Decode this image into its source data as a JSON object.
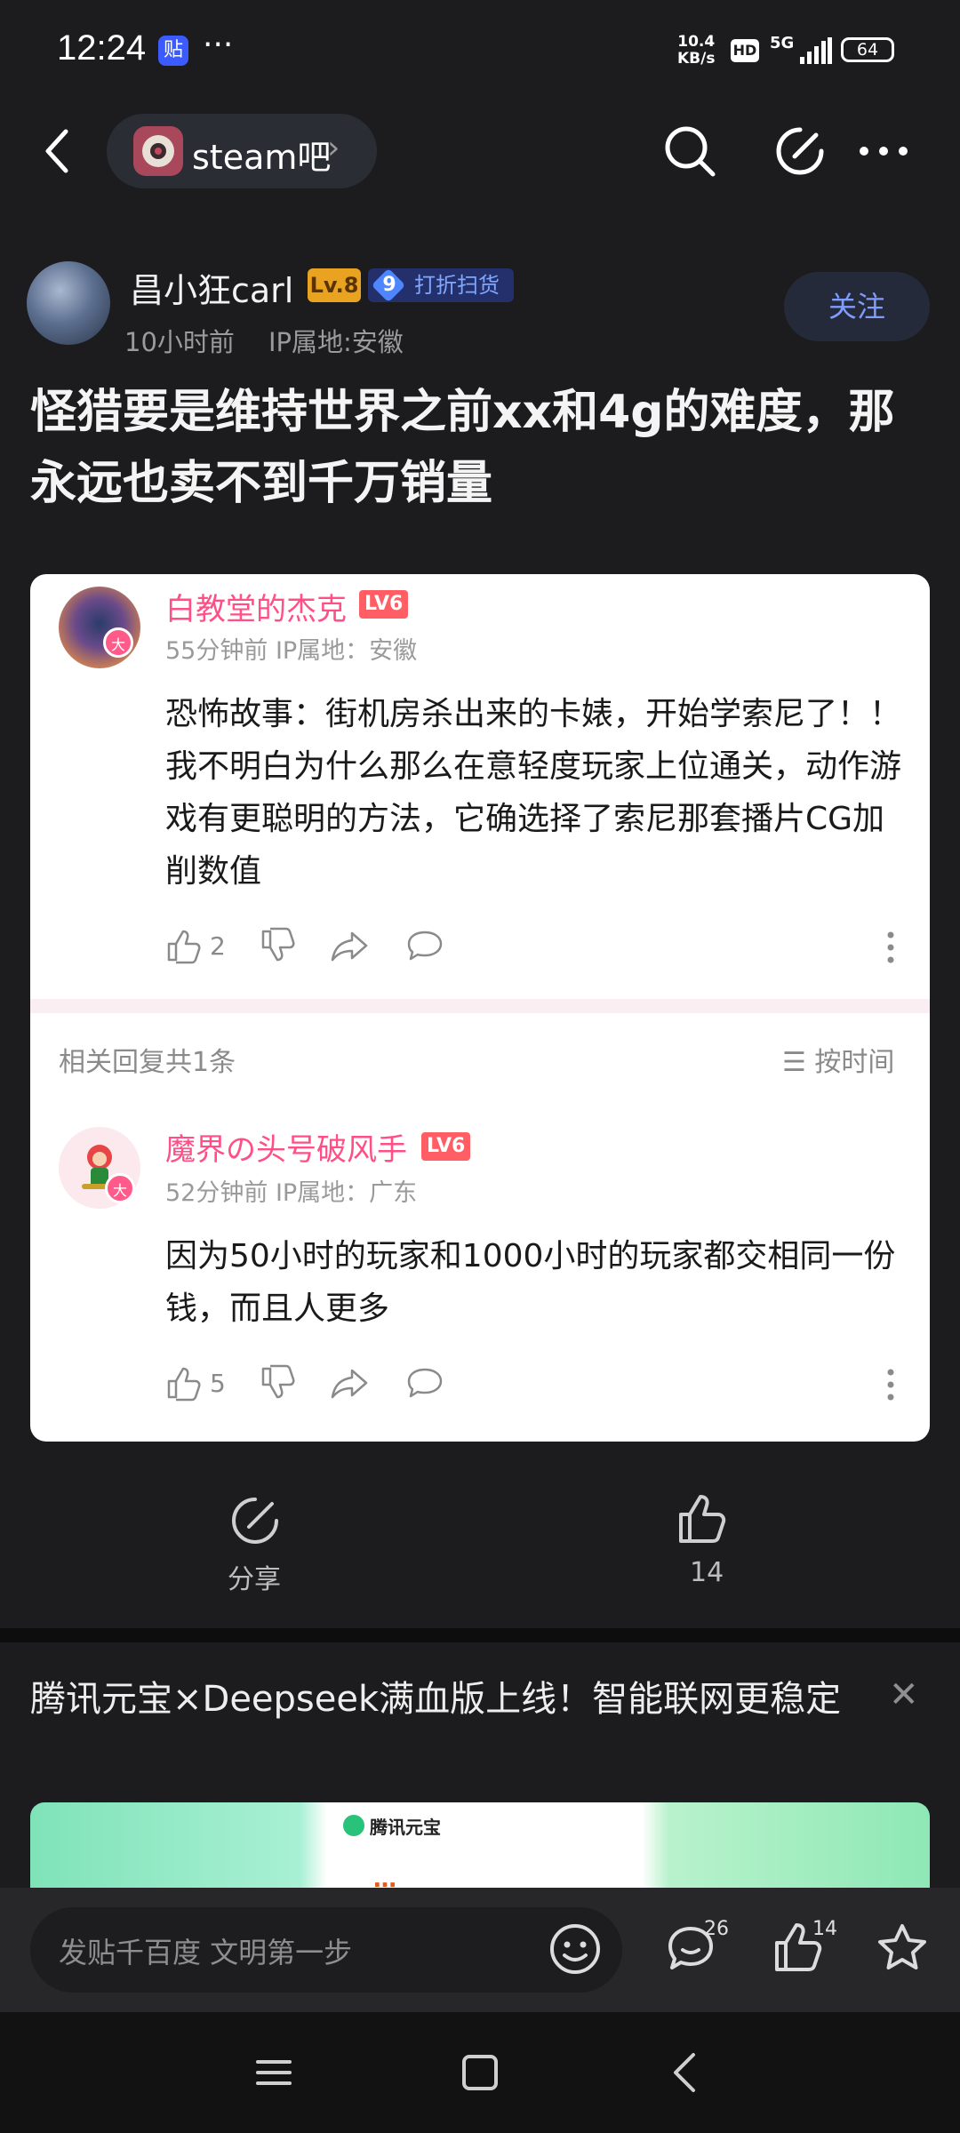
{
  "status_bar": {
    "time": "12:24",
    "app_badge": "贴",
    "more": "···",
    "speed_value": "10.4",
    "speed_unit": "KB/s",
    "hd": "HD",
    "network": "5G",
    "battery": "64"
  },
  "header": {
    "forum_name": "steam吧",
    "forum_chevron": "›",
    "icons": [
      "back-icon",
      "search-icon",
      "edit-icon",
      "more-icon"
    ]
  },
  "post": {
    "author": "昌小狂carl",
    "level": "Lv.8",
    "fan_level": "9",
    "fan_badge": "打折扫货",
    "time": "10小时前",
    "ip": "IP属地:安徽",
    "follow_label": "关注",
    "title": "怪猎要是维持世界之前xx和4g的难度，那永远也卖不到千万销量"
  },
  "comments": [
    {
      "name": "白教堂的杰克",
      "level": "LV6",
      "vip": "大",
      "meta": "55分钟前  IP属地：安徽",
      "text": "恐怖故事：街机房杀出来的卡婊，开始学索尼了！！我不明白为什么那么在意轻度玩家上位通关，动作游戏有更聪明的方法，它确选择了索尼那套播片CG加削数值",
      "likes": "2"
    },
    {
      "name": "魔界の头号破风手",
      "level": "LV6",
      "vip": "大",
      "meta": "52分钟前  IP属地：广东",
      "text": "因为50小时的玩家和1000小时的玩家都交相同一份钱，而且人更多",
      "likes": "5"
    }
  ],
  "related": {
    "count_label": "相关回复共1条",
    "sort_label": "☰ 按时间"
  },
  "actions": {
    "share_label": "分享",
    "like_count": "14"
  },
  "ad": {
    "title": "腾讯元宝×Deepseek满血版上线！智能联网更稳定",
    "close": "✕",
    "logo_text": "腾讯元宝",
    "art_text": "…"
  },
  "bottom_bar": {
    "placeholder": "发贴千百度 文明第一步",
    "reply_count": "26",
    "like_count": "14"
  },
  "colors": {
    "background": "#1c1c1e",
    "accent_blue": "#7f9cff",
    "username_pink": "#ff4f86",
    "level_gold": "#e9a320"
  }
}
